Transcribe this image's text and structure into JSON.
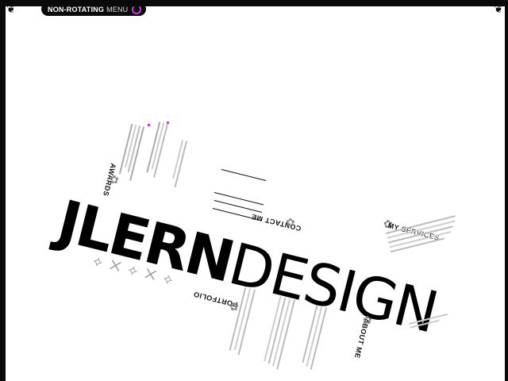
{
  "menu": {
    "label_bold": "NON-ROTATING",
    "label_light": "MENU",
    "icon": "refresh-icon"
  },
  "logo": {
    "bold": "JLERN",
    "light": "DESIGN"
  },
  "sections": {
    "awards": "AWARDS",
    "contact": "CONTACT ME",
    "services_bold": "MY",
    "services_light": "SERVICES",
    "portfolio": "PORTFOLIO",
    "about": "ABOUT ME"
  },
  "colors": {
    "frame": "#0a0a0a",
    "accent": "#d23ad8"
  }
}
